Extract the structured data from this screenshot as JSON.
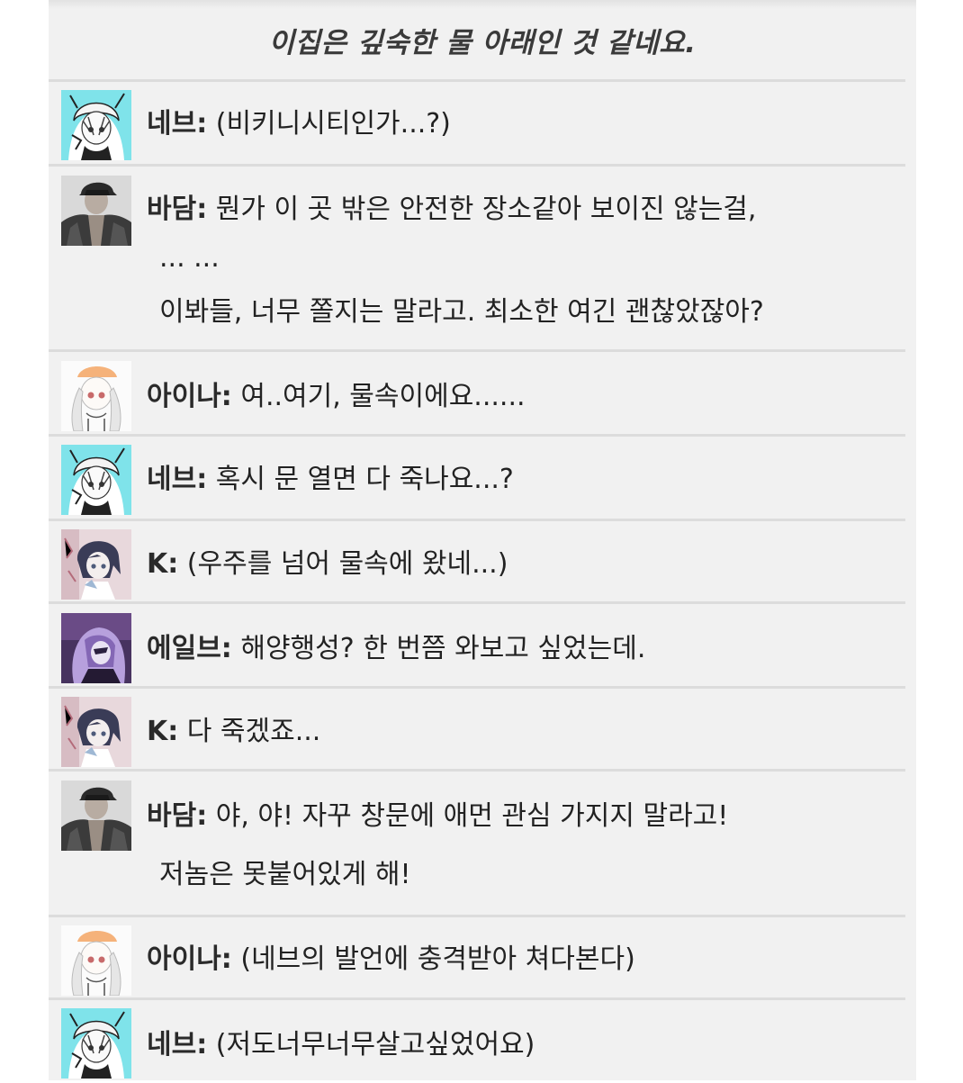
{
  "narration": "이집은 깊숙한 물 아래인 것 같네요.",
  "messages": [
    {
      "speaker": "네브:",
      "avatar": "neb-avatar",
      "lines": [
        "(비키니시티인가...?)"
      ]
    },
    {
      "speaker": "바담:",
      "avatar": "badam-avatar",
      "lines": [
        "뭔가 이 곳 밖은 안전한 장소같아 보이진 않는걸,",
        "... ...",
        "이봐들, 너무 쫄지는 말라고. 최소한 여긴 괜찮았잖아?"
      ]
    },
    {
      "speaker": "아이나:",
      "avatar": "aina-avatar",
      "lines": [
        "여..여기, 물속이에요......"
      ]
    },
    {
      "speaker": "네브:",
      "avatar": "neb-avatar",
      "lines": [
        "혹시 문 열면 다 죽나요...?"
      ]
    },
    {
      "speaker": "K:",
      "avatar": "k-avatar",
      "lines": [
        "(우주를 넘어 물속에 왔네...)"
      ]
    },
    {
      "speaker": "에일브:",
      "avatar": "elve-avatar",
      "lines": [
        "해양행성? 한 번쯤 와보고 싶었는데."
      ]
    },
    {
      "speaker": "K:",
      "avatar": "k-avatar",
      "lines": [
        "다 죽겠죠..."
      ]
    },
    {
      "speaker": "바담:",
      "avatar": "badam-avatar",
      "lines": [
        "야, 야! 자꾸 창문에 애먼 관심 가지지 말라고!",
        "저놈은 못붙어있게 해!"
      ]
    },
    {
      "speaker": "아이나:",
      "avatar": "aina-avatar",
      "lines": [
        "(네브의 발언에 충격받아 쳐다본다)"
      ]
    },
    {
      "speaker": "네브:",
      "avatar": "neb-avatar",
      "lines": [
        "(저도너무너무살고싶었어요)"
      ]
    }
  ]
}
